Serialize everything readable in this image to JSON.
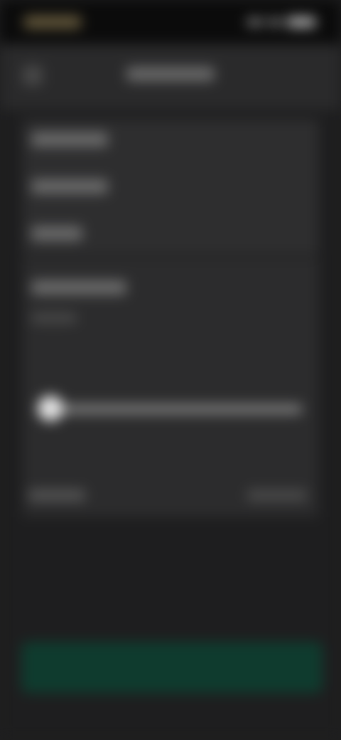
{
  "status_bar": {
    "time": "",
    "icons": [
      "signal-icon",
      "wifi-icon",
      "battery-icon"
    ]
  },
  "nav": {
    "title": ""
  },
  "settings": {
    "rows": [
      {
        "label": ""
      },
      {
        "label": ""
      },
      {
        "label": ""
      }
    ]
  },
  "brightness": {
    "title": "",
    "value_text": "",
    "level": 0.05,
    "bottom_left": "",
    "bottom_right": ""
  },
  "action": {
    "label": ""
  },
  "colors": {
    "background": "#1e1e1f",
    "status_bar": "#0b0b0b",
    "nav_bar": "#2a2a2b",
    "card": "#2e2e2f",
    "slider_thumb": "#e4e4e4",
    "primary_button": "#0f3b2e"
  }
}
